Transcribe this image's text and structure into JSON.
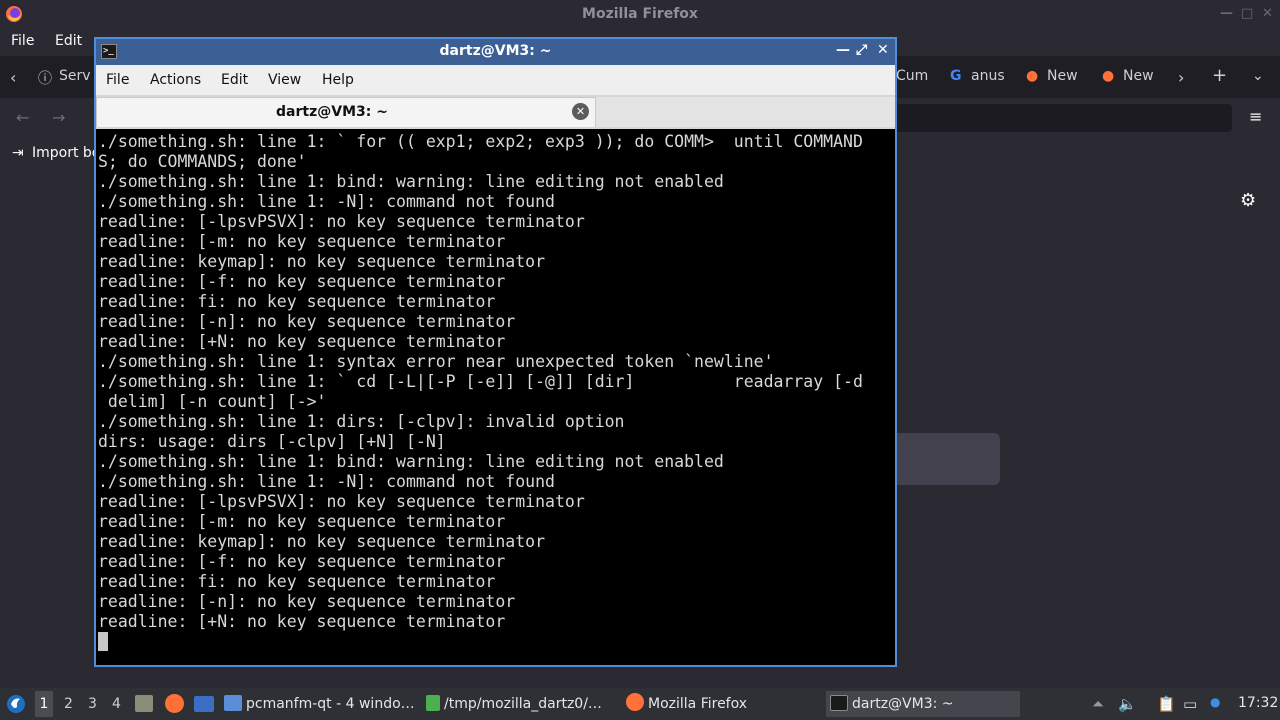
{
  "firefox": {
    "title": "Mozilla Firefox",
    "menu": [
      "File",
      "Edit"
    ],
    "tabs": [
      "Serv",
      "Cum",
      "anus",
      "New",
      "New"
    ],
    "bookmarks_label": "Import bo"
  },
  "terminal": {
    "title": "dartz@VM3: ~",
    "menu": [
      "File",
      "Actions",
      "Edit",
      "View",
      "Help"
    ],
    "tab_label": "dartz@VM3: ~",
    "lines": [
      "./something.sh: line 1: ` for (( exp1; exp2; exp3 )); do COMM>  until COMMAND",
      "S; do COMMANDS; done'",
      "./something.sh: line 1: bind: warning: line editing not enabled",
      "./something.sh: line 1: -N]: command not found",
      "readline: [-lpsvPSVX]: no key sequence terminator",
      "readline: [-m: no key sequence terminator",
      "readline: keymap]: no key sequence terminator",
      "readline: [-f: no key sequence terminator",
      "readline: fi: no key sequence terminator",
      "readline: [-n]: no key sequence terminator",
      "readline: [+N: no key sequence terminator",
      "./something.sh: line 1: syntax error near unexpected token `newline'",
      "./something.sh: line 1: ` cd [-L|[-P [-e]] [-@]] [dir]          readarray [-d",
      " delim] [-n count] [->'",
      "./something.sh: line 1: dirs: [-clpv]: invalid option",
      "dirs: usage: dirs [-clpv] [+N] [-N]",
      "./something.sh: line 1: bind: warning: line editing not enabled",
      "./something.sh: line 1: -N]: command not found",
      "readline: [-lpsvPSVX]: no key sequence terminator",
      "readline: [-m: no key sequence terminator",
      "readline: keymap]: no key sequence terminator",
      "readline: [-f: no key sequence terminator",
      "readline: fi: no key sequence terminator",
      "readline: [-n]: no key sequence terminator",
      "readline: [+N: no key sequence terminator"
    ]
  },
  "taskbar": {
    "workspaces": [
      "1",
      "2",
      "3",
      "4"
    ],
    "tasks": [
      {
        "label": "pcmanfm-qt - 4 windo…",
        "icon": "folder-icon",
        "active": false
      },
      {
        "label": "/tmp/mozilla_dartz0/…",
        "icon": "archive-icon",
        "active": false
      },
      {
        "label": "Mozilla Firefox",
        "icon": "firefox-icon",
        "active": false
      },
      {
        "label": "dartz@VM3: ~",
        "icon": "terminal-icon",
        "active": true
      }
    ],
    "clock": "17:32"
  },
  "colors": {
    "terminal_title_bg": "#3c5f96",
    "terminal_border": "#4f8ed8",
    "terminal_bg": "#000000",
    "terminal_fg": "#d8d8d8",
    "taskbar_bg": "#2e3035",
    "firefox_bg": "#2b2a33"
  }
}
